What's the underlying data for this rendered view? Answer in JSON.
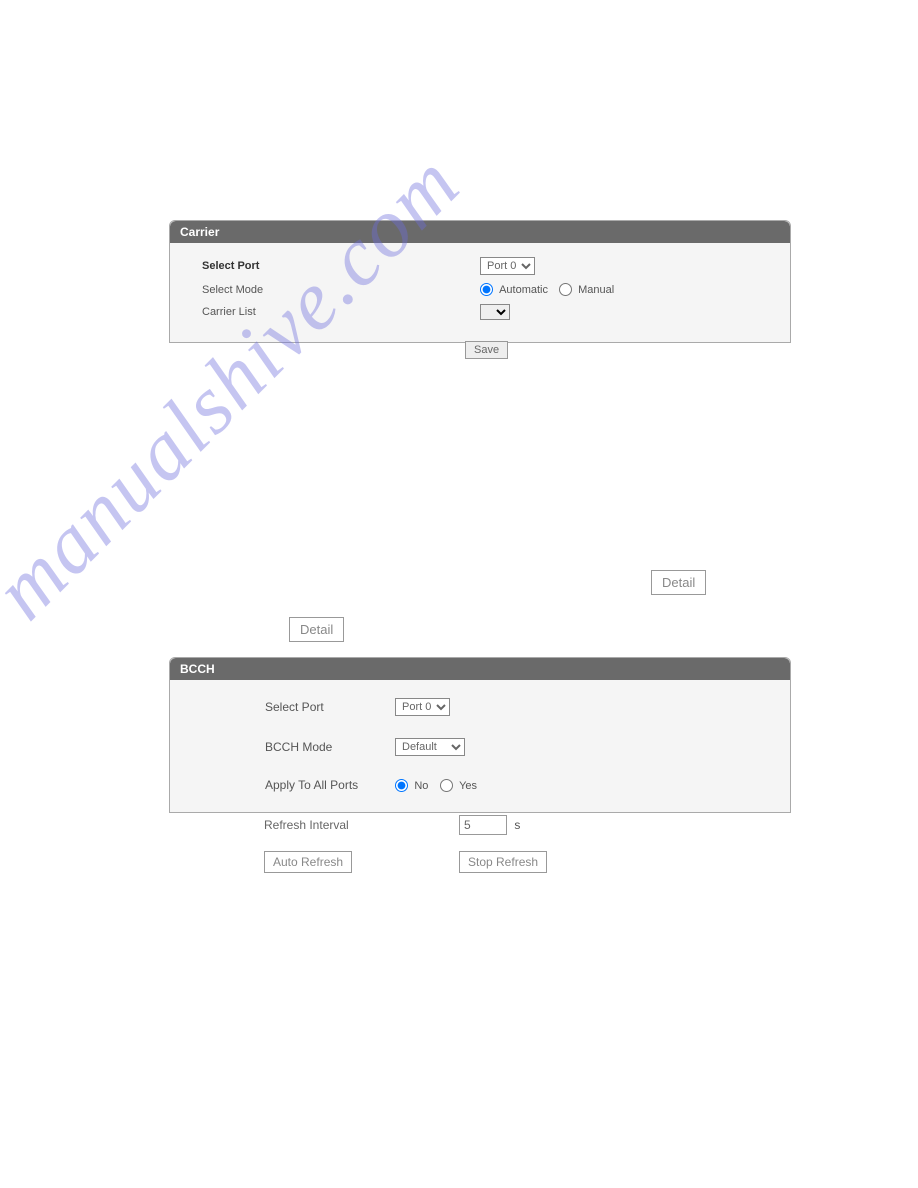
{
  "watermark": "manualshive.com",
  "carrier": {
    "title": "Carrier",
    "selectPortLabel": "Select Port",
    "selectPortValue": "Port 0",
    "selectModeLabel": "Select Mode",
    "modeAutomatic": "Automatic",
    "modeManual": "Manual",
    "carrierListLabel": "Carrier List",
    "saveLabel": "Save"
  },
  "detailLabel": "Detail",
  "bcch": {
    "title": "BCCH",
    "selectPortLabel": "Select Port",
    "selectPortValue": "Port 0",
    "bcchModeLabel": "BCCH Mode",
    "bcchModeValue": "Default",
    "applyAllLabel": "Apply To All Ports",
    "noLabel": "No",
    "yesLabel": "Yes",
    "refreshIntervalLabel": "Refresh Interval",
    "refreshIntervalValue": "5",
    "refreshUnit": "s",
    "autoRefreshLabel": "Auto Refresh",
    "stopRefreshLabel": "Stop Refresh"
  }
}
